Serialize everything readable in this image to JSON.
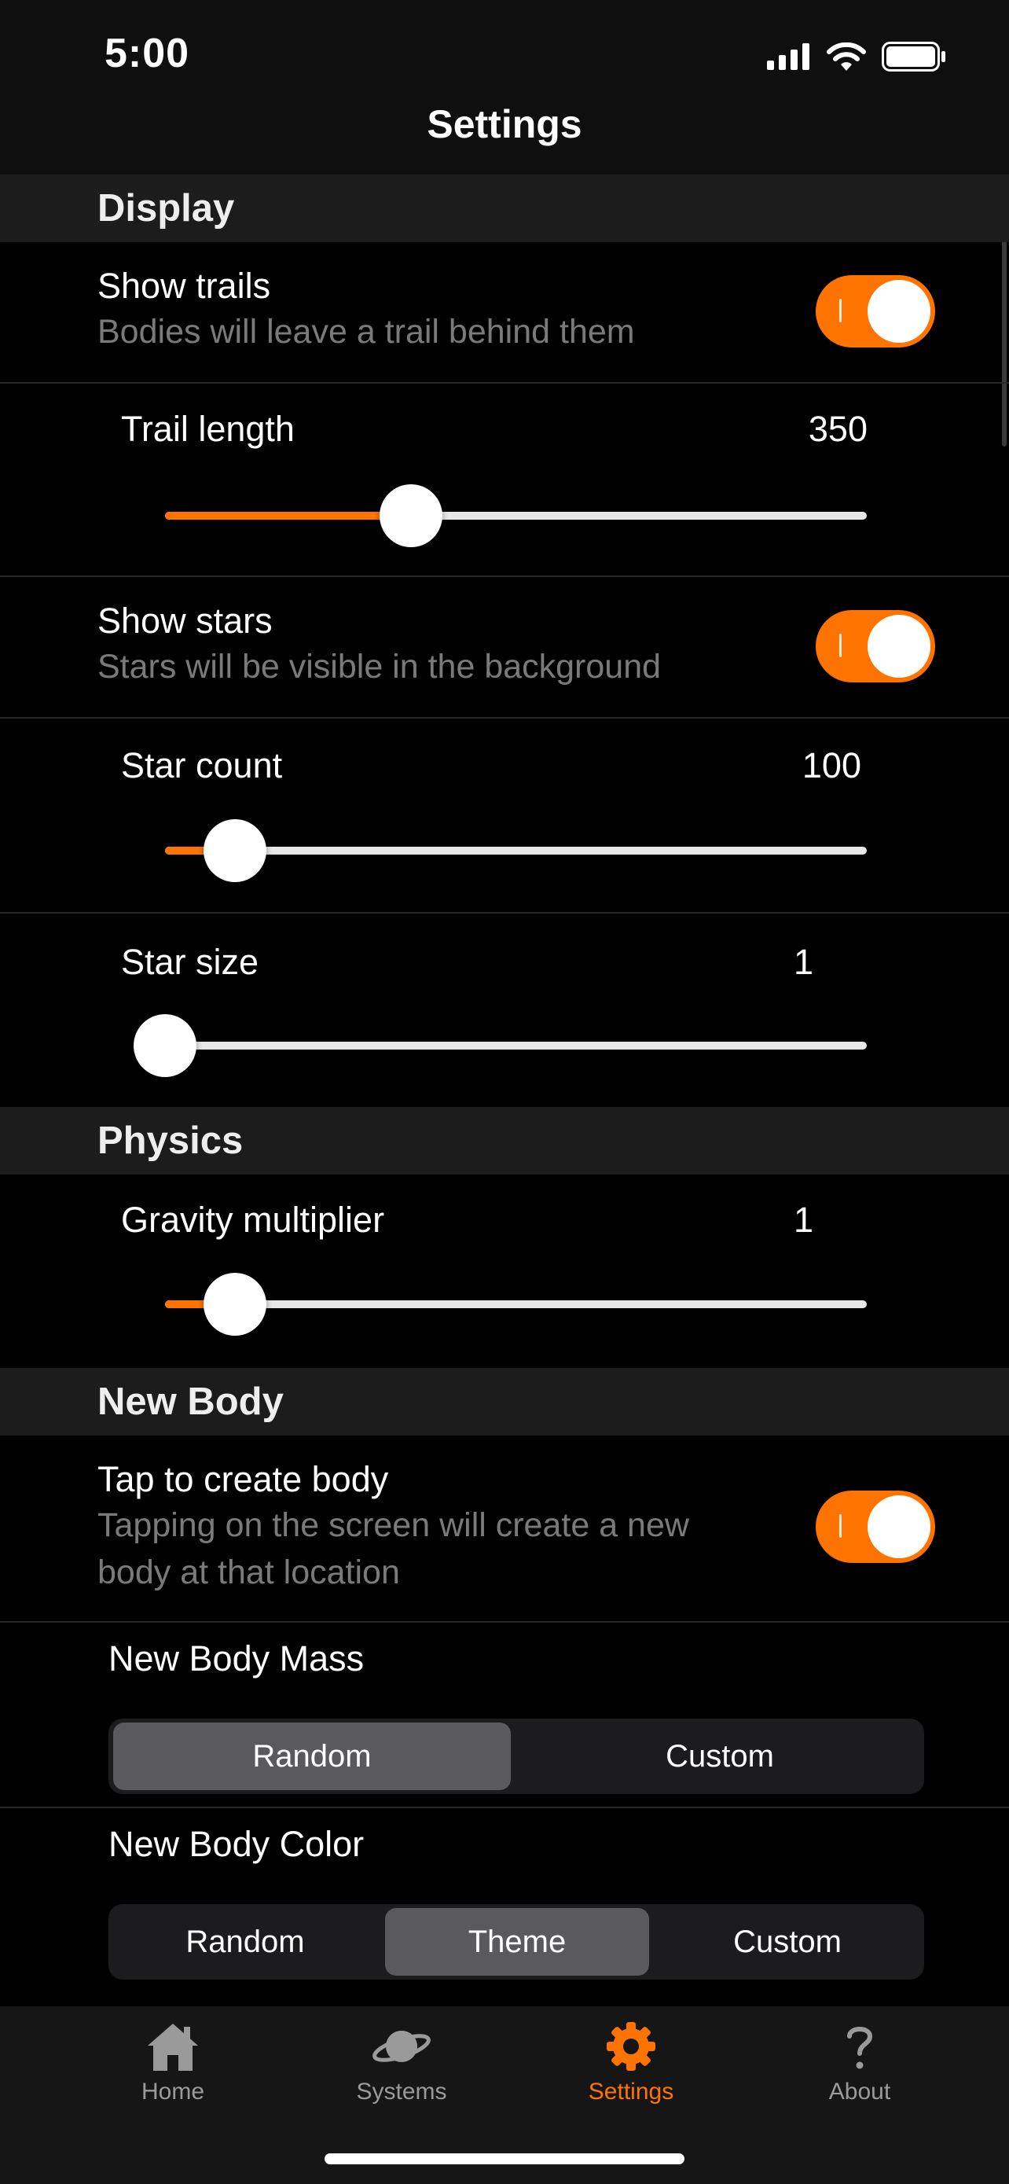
{
  "status": {
    "time": "5:00"
  },
  "nav": {
    "title": "Settings"
  },
  "sections": {
    "display": "Display",
    "physics": "Physics",
    "new_body": "New Body"
  },
  "show_trails": {
    "title": "Show trails",
    "subtitle": "Bodies will leave a trail behind them",
    "on": true
  },
  "trail_length": {
    "label": "Trail length",
    "value": "350",
    "fraction": 0.35
  },
  "show_stars": {
    "title": "Show stars",
    "subtitle": "Stars will be visible in the background",
    "on": true
  },
  "star_count": {
    "label": "Star count",
    "value": "100",
    "fraction": 0.1
  },
  "star_size": {
    "label": "Star size",
    "value": "1",
    "fraction": 0.0
  },
  "gravity": {
    "label": "Gravity multiplier",
    "value": "1",
    "fraction": 0.1
  },
  "tap_create": {
    "title": "Tap to create body",
    "subtitle_line1": "Tapping on the screen will create a new",
    "subtitle_line2": "body at that location",
    "on": true
  },
  "mass": {
    "label": "New Body Mass",
    "options": [
      "Random",
      "Custom"
    ],
    "selected": "Random"
  },
  "color": {
    "label": "New Body Color",
    "options": [
      "Random",
      "Theme",
      "Custom"
    ],
    "selected": "Theme"
  },
  "tabs": [
    {
      "label": "Home",
      "icon": "house-icon"
    },
    {
      "label": "Systems",
      "icon": "planet-icon"
    },
    {
      "label": "Settings",
      "icon": "gear-icon",
      "active": true
    },
    {
      "label": "About",
      "icon": "question-mark-icon"
    }
  ],
  "colors": {
    "accent": "#ff7400",
    "background": "#000000",
    "section": "#1c1c1c"
  }
}
